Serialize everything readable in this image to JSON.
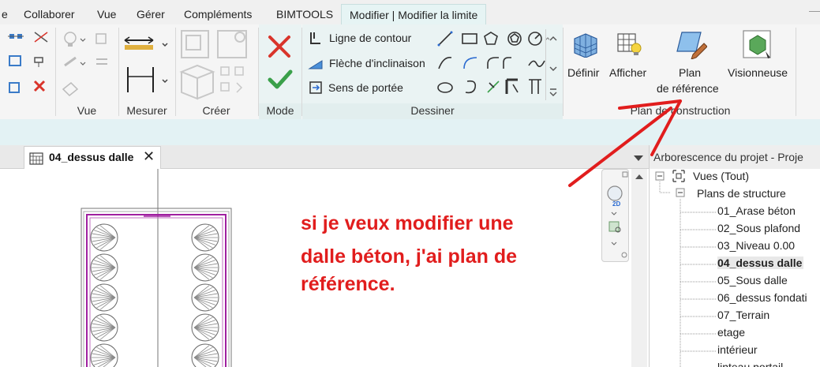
{
  "ribbon_tabs": [
    {
      "label": "e"
    },
    {
      "label": "Collaborer"
    },
    {
      "label": "Vue"
    },
    {
      "label": "Gérer"
    },
    {
      "label": "Compléments"
    },
    {
      "label": "BIMTOOLS"
    },
    {
      "label": "Modifier | Modifier la limite"
    }
  ],
  "panels": {
    "vue": "Vue",
    "mesurer": "Mesurer",
    "creer": "Créer",
    "mode": "Mode",
    "dessiner": "Dessiner",
    "plan_construction": "Plan de construction"
  },
  "dessiner_buttons": {
    "ligne_contour": "Ligne de contour",
    "fleche_inclinaison": "Flèche d'inclinaison",
    "sens_portee": "Sens de portée"
  },
  "plan_buttons": {
    "definir": "Définir",
    "afficher": "Afficher",
    "plan_line1": "Plan",
    "plan_line2": "de référence",
    "visionneuse": "Visionneuse"
  },
  "view_tab": {
    "title": "04_dessus dalle",
    "close": "✕"
  },
  "browser": {
    "header": "Arborescence du projet - Proje",
    "root": "Vues (Tout)",
    "group": "Plans de structure",
    "items": [
      "01_Arase béton",
      "02_Sous plafond",
      "03_Niveau 0.00",
      "04_dessus dalle",
      "05_Sous dalle",
      "06_dessus fondati",
      "07_Terrain",
      "etage",
      "intérieur",
      "linteau portail"
    ]
  },
  "annotation": {
    "line1": "si je veux modifier une",
    "line2": "dalle béton, j'ai plan de",
    "line3": "référence."
  },
  "nav_bar": {
    "zoom_label": "2D"
  },
  "colors": {
    "accent_tab": "#e6f4f4",
    "annotation_red": "#e11d1d",
    "mode_cancel": "#d9342b",
    "mode_finish": "#3aa04a"
  }
}
